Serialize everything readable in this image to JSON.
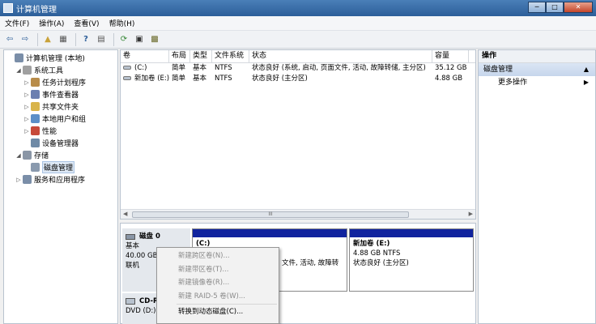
{
  "window": {
    "title": "计算机管理",
    "controls": [
      "─",
      "□",
      "✕"
    ]
  },
  "menu": [
    "文件(F)",
    "操作(A)",
    "查看(V)",
    "帮助(H)"
  ],
  "tree": [
    {
      "label": "计算机管理 (本地)",
      "indent": 0,
      "exp": "",
      "color": "#7a8ea8"
    },
    {
      "label": "系统工具",
      "indent": 1,
      "exp": "◢",
      "color": "#a0a0a0"
    },
    {
      "label": "任务计划程序",
      "indent": 2,
      "exp": "▷",
      "color": "#b88c4a"
    },
    {
      "label": "事件查看器",
      "indent": 2,
      "exp": "▷",
      "color": "#6b7fb0"
    },
    {
      "label": "共享文件夹",
      "indent": 2,
      "exp": "▷",
      "color": "#d9b44a"
    },
    {
      "label": "本地用户和组",
      "indent": 2,
      "exp": "▷",
      "color": "#5c8fc7"
    },
    {
      "label": "性能",
      "indent": 2,
      "exp": "▷",
      "color": "#c74a3a"
    },
    {
      "label": "设备管理器",
      "indent": 2,
      "exp": "",
      "color": "#6f8aa6"
    },
    {
      "label": "存储",
      "indent": 1,
      "exp": "◢",
      "color": "#8a96a6"
    },
    {
      "label": "磁盘管理",
      "indent": 2,
      "exp": "",
      "color": "#8a9aae",
      "selected": true
    },
    {
      "label": "服务和应用程序",
      "indent": 1,
      "exp": "▷",
      "color": "#7a8ea8"
    }
  ],
  "volumes": {
    "headers": [
      "卷",
      "布局",
      "类型",
      "文件系统",
      "状态",
      "容量"
    ],
    "rows": [
      [
        "(C:)",
        "简单",
        "基本",
        "NTFS",
        "状态良好 (系统, 启动, 页面文件, 活动, 故障转储, 主分区)",
        "35.12 GB"
      ],
      [
        "新加卷 (E:)",
        "简单",
        "基本",
        "NTFS",
        "状态良好 (主分区)",
        "4.88 GB"
      ]
    ],
    "scroll_grip": "III"
  },
  "disk0": {
    "name": "磁盘 0",
    "type": "基本",
    "size": "40.00 GB",
    "status": "联机",
    "partition_c": {
      "name": "(C:)",
      "status_tail": "文件, 活动, 故障转"
    },
    "partition_e": {
      "name": "新加卷 (E:)",
      "size_fs": "4.88 GB NTFS",
      "status": "状态良好 (主分区)"
    }
  },
  "cdrom": {
    "name": "CD-R",
    "label": "DVD (D:)"
  },
  "context_menu": [
    {
      "label": "新建跨区卷(N)...",
      "enabled": false
    },
    {
      "label": "新建带区卷(T)...",
      "enabled": false
    },
    {
      "label": "新建镜像卷(R)...",
      "enabled": false
    },
    {
      "label": "新建 RAID-5 卷(W)...",
      "enabled": false
    },
    {
      "label": "转换到动态磁盘(C)...",
      "enabled": true
    }
  ],
  "actions": {
    "header": "操作",
    "section": "磁盘管理",
    "more": "更多操作"
  }
}
